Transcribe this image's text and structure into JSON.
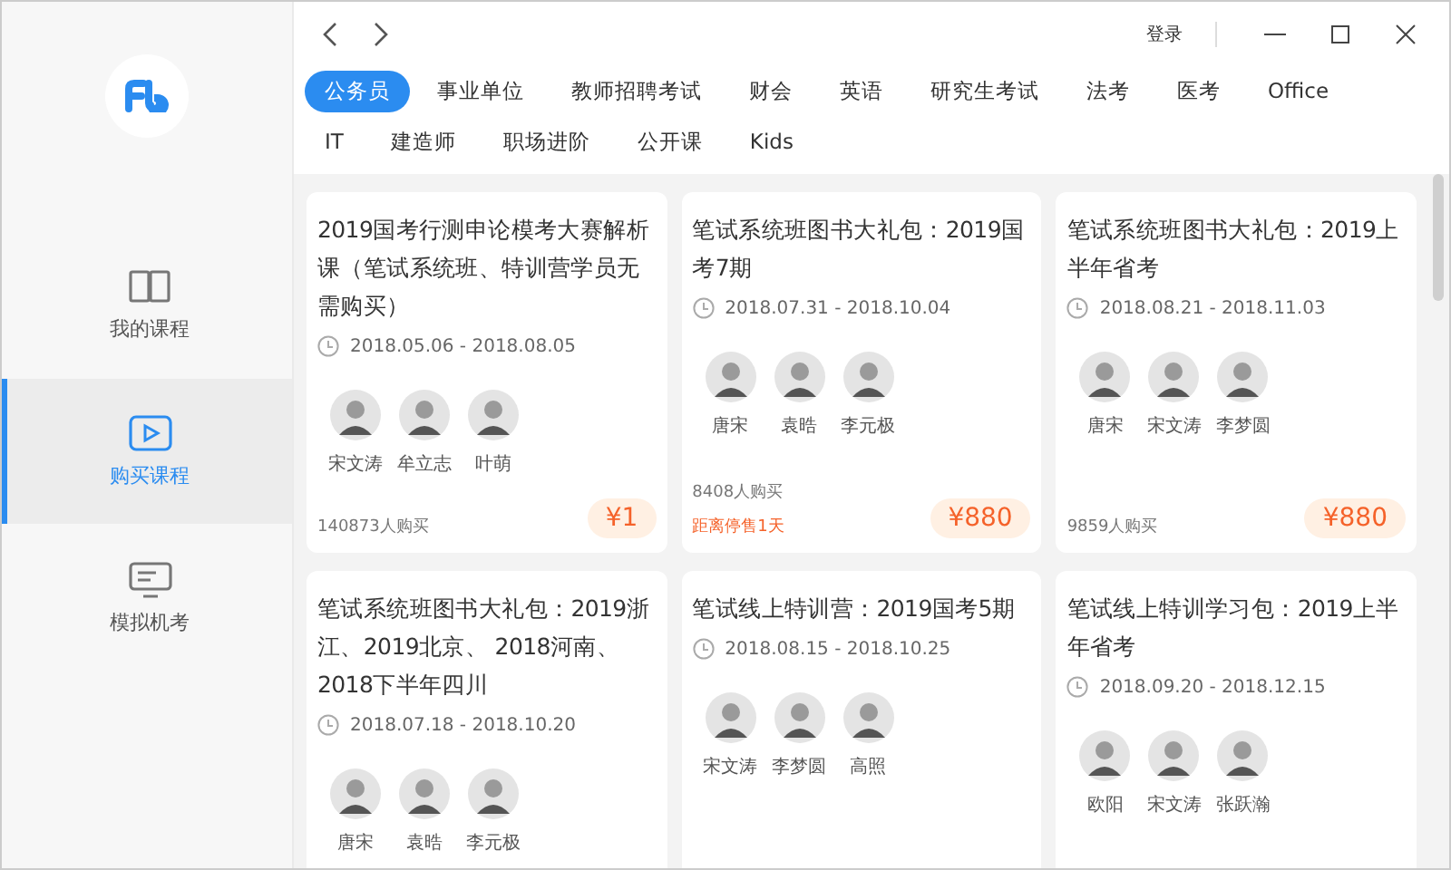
{
  "topbar": {
    "login": "登录"
  },
  "sidebar": {
    "items": [
      {
        "label": "我的课程",
        "selected": false
      },
      {
        "label": "购买课程",
        "selected": true
      },
      {
        "label": "模拟机考",
        "selected": false
      }
    ]
  },
  "tabs": [
    [
      {
        "label": "公务员",
        "selected": true
      },
      {
        "label": "事业单位",
        "selected": false
      },
      {
        "label": "教师招聘考试",
        "selected": false
      },
      {
        "label": "财会",
        "selected": false
      },
      {
        "label": "英语",
        "selected": false
      },
      {
        "label": "研究生考试",
        "selected": false
      },
      {
        "label": "法考",
        "selected": false
      },
      {
        "label": "医考",
        "selected": false
      },
      {
        "label": "Office",
        "selected": false
      }
    ],
    [
      {
        "label": "IT",
        "selected": false
      },
      {
        "label": "建造师",
        "selected": false
      },
      {
        "label": "职场进阶",
        "selected": false
      },
      {
        "label": "公开课",
        "selected": false
      },
      {
        "label": "Kids",
        "selected": false
      }
    ]
  ],
  "courses": [
    {
      "title": "2019国考行测申论模考大赛解析课（笔试系统班、特训营学员无需购买）",
      "dates": "2018.05.06 - 2018.08.05",
      "teachers": [
        "宋文涛",
        "牟立志",
        "叶萌"
      ],
      "buyers": "140873人购买",
      "price": "¥1"
    },
    {
      "title": "笔试系统班图书大礼包：2019国考7期",
      "dates": "2018.07.31 - 2018.10.04",
      "teachers": [
        "唐宋",
        "袁晧",
        "李元极"
      ],
      "buyers": "8408人购买",
      "notice": "距离停售1天",
      "price": "¥880"
    },
    {
      "title": "笔试系统班图书大礼包：2019上半年省考",
      "dates": "2018.08.21 - 2018.11.03",
      "teachers": [
        "唐宋",
        "宋文涛",
        "李梦圆"
      ],
      "buyers": "9859人购买",
      "price": "¥880"
    },
    {
      "title": "笔试系统班图书大礼包：2019浙江、2019北京、 2018河南、2018下半年四川",
      "dates": "2018.07.18 - 2018.10.20",
      "teachers": [
        "唐宋",
        "袁晧",
        "李元极"
      ]
    },
    {
      "title": "笔试线上特训营：2019国考5期",
      "dates": "2018.08.15 - 2018.10.25",
      "teachers": [
        "宋文涛",
        "李梦圆",
        "高照"
      ]
    },
    {
      "title": "笔试线上特训学习包：2019上半年省考",
      "dates": "2018.09.20 - 2018.12.15",
      "teachers": [
        "欧阳",
        "宋文涛",
        "张跃瀚"
      ]
    }
  ]
}
